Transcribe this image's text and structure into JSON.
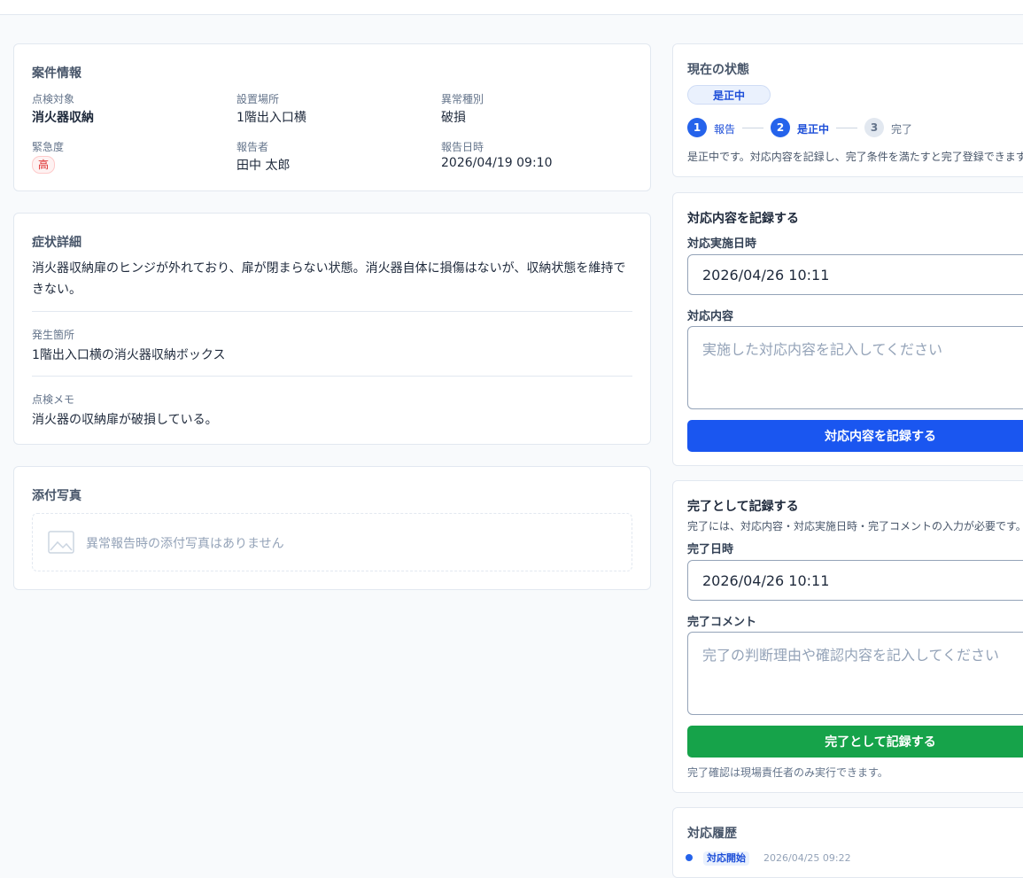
{
  "case_info": {
    "title": "案件情報",
    "fields": [
      {
        "label": "点検対象",
        "value": "消火器収納"
      },
      {
        "label": "設置場所",
        "value": "1階出入口横"
      },
      {
        "label": "異常種別",
        "value": "破損"
      },
      {
        "label": "緊急度",
        "value": "高"
      },
      {
        "label": "報告者",
        "value": "田中 太郎"
      },
      {
        "label": "報告日時",
        "value": "2026/04/19 09:10"
      }
    ]
  },
  "symptom": {
    "title": "症状詳細",
    "description_line1": "消火器収納扉のヒンジが外れており、扉が閉まらない状態。消火器自体に損傷はないが、収納状態を維持で",
    "description_line2": "きない。",
    "location_label": "発生箇所",
    "location_value": "1階出入口横の消火器収納ボックス",
    "memo_label": "点検メモ",
    "memo_value": "消火器の収納扉が破損している。"
  },
  "photos": {
    "title": "添付写真",
    "empty_text": "異常報告時の添付写真はありません"
  },
  "status": {
    "title": "現在の状態",
    "current": "是正中",
    "steps": [
      {
        "num": "1",
        "label": "報告"
      },
      {
        "num": "2",
        "label": "是正中"
      },
      {
        "num": "3",
        "label": "完了"
      }
    ],
    "description": "是正中です。対応内容を記録し、完了条件を満たすと完了登録できます"
  },
  "response": {
    "title": "対応内容を記録する",
    "date_label": "対応実施日時",
    "date_value": "2026/04/26 10:11",
    "content_label": "対応内容",
    "content_placeholder": "実施した対応内容を記入してください",
    "submit_label": "対応内容を記録する"
  },
  "completion": {
    "title": "完了として記録する",
    "note": "完了には、対応内容・対応実施日時・完了コメントの入力が必要です。",
    "date_label": "完了日時",
    "date_value": "2026/04/26 10:11",
    "comment_label": "完了コメント",
    "comment_placeholder": "完了の判断理由や確認内容を記入してください",
    "submit_label": "完了として記録する",
    "permission_note": "完了確認は現場責任者のみ実行できます。"
  },
  "history": {
    "title": "対応履歴",
    "items": [
      {
        "tag": "対応開始",
        "time": "2026/04/25 09:22"
      }
    ]
  },
  "colors": {
    "primary": "#1a56f0",
    "success": "#16a34a",
    "danger": "#dc2626"
  }
}
